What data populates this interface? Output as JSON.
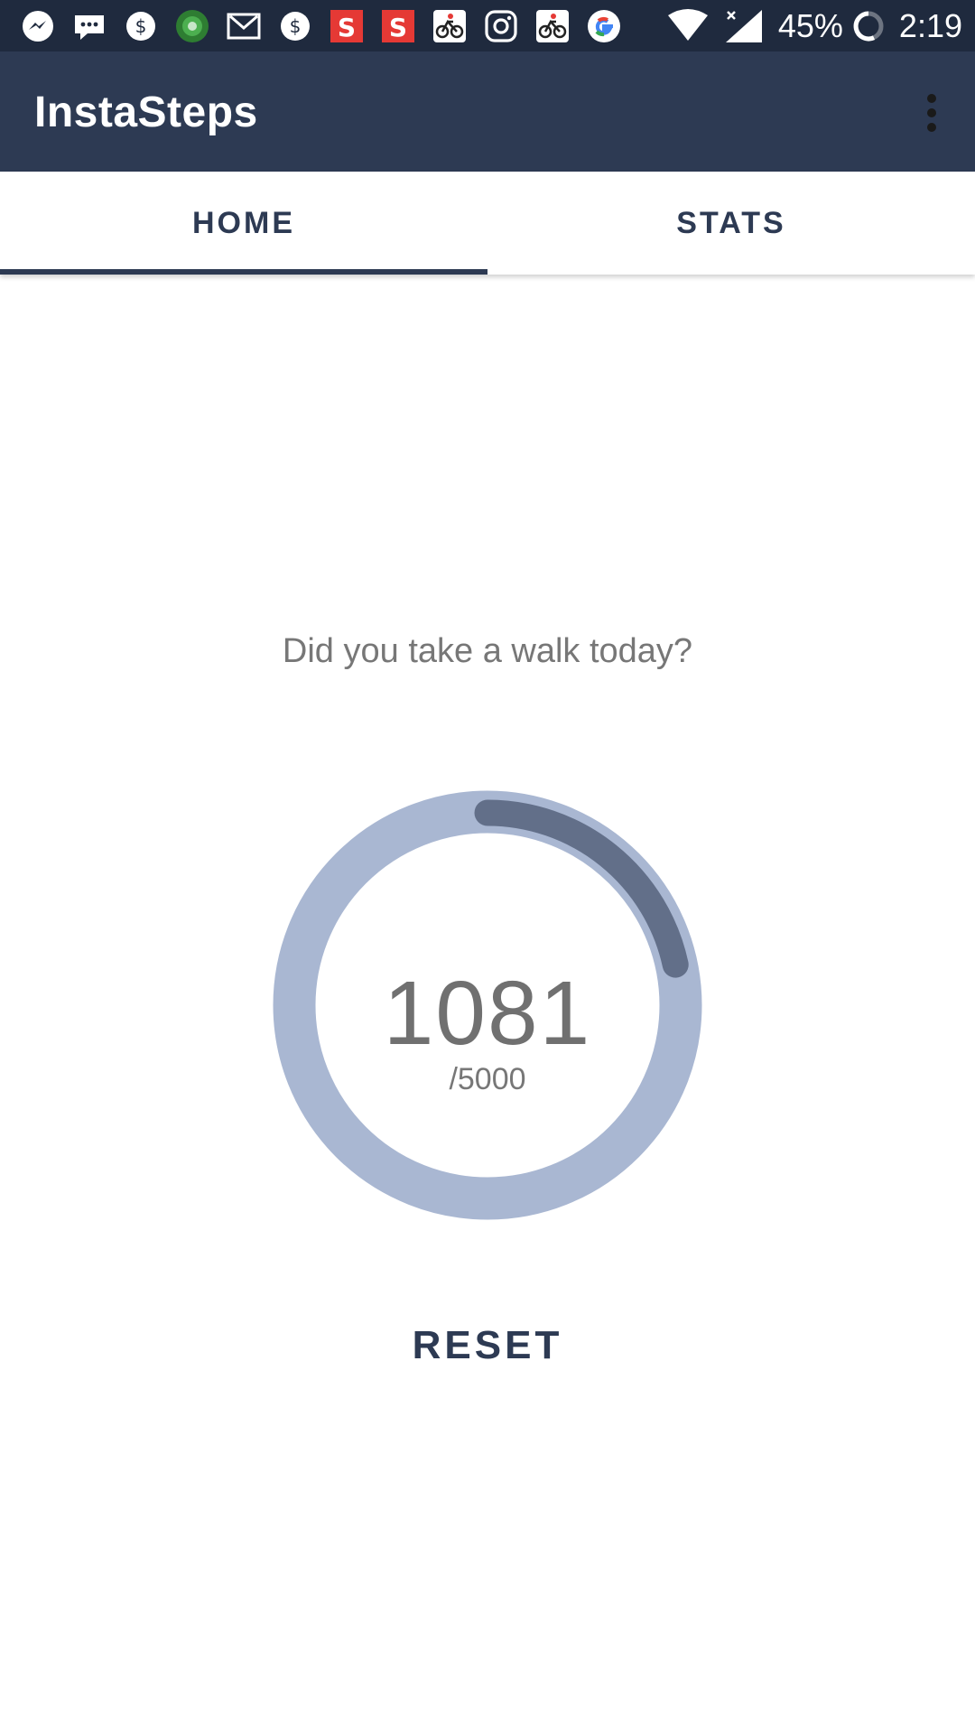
{
  "status_bar": {
    "notification_icons": [
      "messenger-icon",
      "chat-icon",
      "dollar-icon",
      "quran-app-icon",
      "gmail-icon",
      "dollar-icon",
      "sony-liv-icon",
      "sony-liv-icon",
      "cycling-icon",
      "instagram-icon",
      "cycling-icon",
      "google-icon"
    ],
    "battery": "45%",
    "time": "2:19"
  },
  "app_bar": {
    "title": "InstaSteps",
    "menu_icon": "more-vert-icon"
  },
  "tabs": [
    {
      "label": "HOME",
      "selected": true
    },
    {
      "label": "STATS",
      "selected": false
    }
  ],
  "main": {
    "prompt": "Did you take a walk today?",
    "steps": "1081",
    "goal": "/5000",
    "progress_fraction": 0.2162,
    "reset_label": "RESET"
  },
  "colors": {
    "status_bar": "#1f2a3e",
    "app_bar": "#2d3a53",
    "accent": "#2d3a53",
    "ring_track": "#a9b7d2",
    "ring_progress": "#626f89",
    "text_muted": "#777777"
  }
}
